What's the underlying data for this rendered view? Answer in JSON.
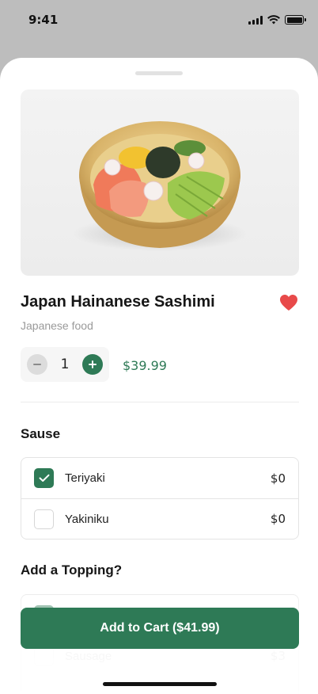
{
  "status_bar": {
    "time": "9:41"
  },
  "product": {
    "title": "Japan Hainanese Sashimi",
    "subtitle": "Japanese food",
    "quantity": "1",
    "price": "$39.99",
    "favorited": true,
    "favorite_color": "#e84a4a"
  },
  "sauce": {
    "title": "Sause",
    "options": [
      {
        "label": "Teriyaki",
        "price": "$0",
        "checked": true
      },
      {
        "label": "Yakiniku",
        "price": "$0",
        "checked": false
      }
    ]
  },
  "topping": {
    "title": "Add a Topping?",
    "options": [
      {
        "label": "Sausage",
        "price": "$3",
        "checked": false
      }
    ]
  },
  "cart": {
    "label": "Add to Cart ($41.99)"
  },
  "colors": {
    "accent": "#2e7a56",
    "heart": "#e84a4a"
  }
}
